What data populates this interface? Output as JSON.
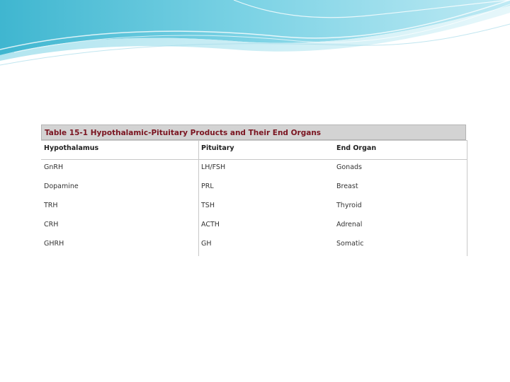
{
  "slide": {
    "theme": {
      "wave_colors": [
        "#4fc0d8",
        "#8fd9e8",
        "#c9eef6"
      ]
    }
  },
  "table": {
    "caption": "Table 15-1 Hypothalamic-Pituitary Products and Their End Organs",
    "caption_color": "#7a1420",
    "columns": [
      "Hypothalamus",
      "Pituitary",
      "End Organ"
    ],
    "rows": [
      [
        "GnRH",
        "LH/FSH",
        "Gonads"
      ],
      [
        "Dopamine",
        "PRL",
        "Breast"
      ],
      [
        "TRH",
        "TSH",
        "Thyroid"
      ],
      [
        "CRH",
        "ACTH",
        "Adrenal"
      ],
      [
        "GHRH",
        "GH",
        "Somatic"
      ]
    ]
  }
}
